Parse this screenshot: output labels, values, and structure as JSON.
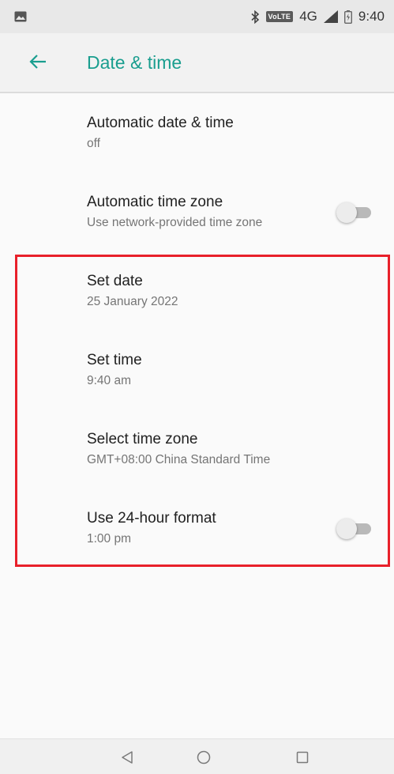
{
  "status_bar": {
    "network_badge": "VoLTE",
    "network_type": "4G",
    "time": "9:40",
    "icons": [
      "gallery-icon",
      "bluetooth-icon",
      "signal-icon",
      "battery-icon"
    ]
  },
  "app_bar": {
    "title": "Date & time",
    "back_icon": "arrow-back-icon",
    "title_color": "#1a9e8f"
  },
  "settings": {
    "items": [
      {
        "title": "Automatic date & time",
        "summary": "off"
      },
      {
        "title": "Automatic time zone",
        "summary": "Use network-provided time zone",
        "toggle": "off"
      },
      {
        "title": "Set date",
        "summary": "25 January 2022"
      },
      {
        "title": "Set time",
        "summary": "9:40 am"
      },
      {
        "title": "Select time zone",
        "summary": "GMT+08:00 China Standard Time"
      },
      {
        "title": "Use 24-hour format",
        "summary": "1:00 pm",
        "toggle": "off"
      }
    ]
  },
  "highlight": {
    "color": "#e8202a"
  },
  "nav_bar": {
    "icons": [
      "back-triangle-icon",
      "home-circle-icon",
      "recents-square-icon"
    ]
  }
}
